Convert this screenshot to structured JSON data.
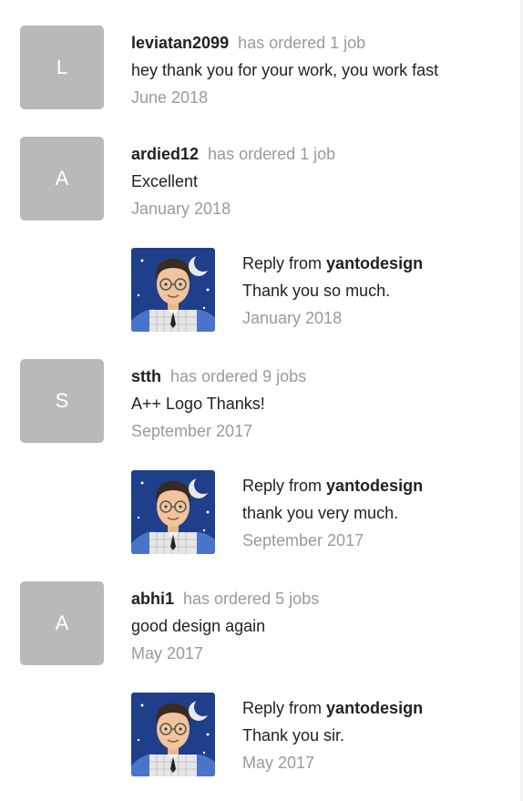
{
  "reviews": [
    {
      "initial": "L",
      "username": "leviatan2099",
      "ordered": "has ordered 1 job",
      "message": "hey thank you for your work, you work fast",
      "date": "June 2018",
      "reply": null
    },
    {
      "initial": "A",
      "username": "ardied12",
      "ordered": "has ordered 1 job",
      "message": "Excellent",
      "date": "January 2018",
      "reply": {
        "prefix": "Reply from",
        "seller": "yantodesign",
        "message": "Thank you so much.",
        "date": "January 2018"
      }
    },
    {
      "initial": "S",
      "username": "stth",
      "ordered": "has ordered 9 jobs",
      "message": "A++ Logo Thanks!",
      "date": "September 2017",
      "reply": {
        "prefix": "Reply from",
        "seller": "yantodesign",
        "message": "thank you very much.",
        "date": "September 2017"
      }
    },
    {
      "initial": "A",
      "username": "abhi1",
      "ordered": "has ordered 5 jobs",
      "message": "good design again",
      "date": "May 2017",
      "reply": {
        "prefix": "Reply from",
        "seller": "yantodesign",
        "message": "Thank you sir.",
        "date": "May 2017"
      }
    }
  ],
  "colors": {
    "letter_avatar_bg": "#b9b9b9",
    "muted_text": "#9a9a9a",
    "primary_text": "#222222",
    "seller_avatar_bg": "#1f3f8a"
  }
}
